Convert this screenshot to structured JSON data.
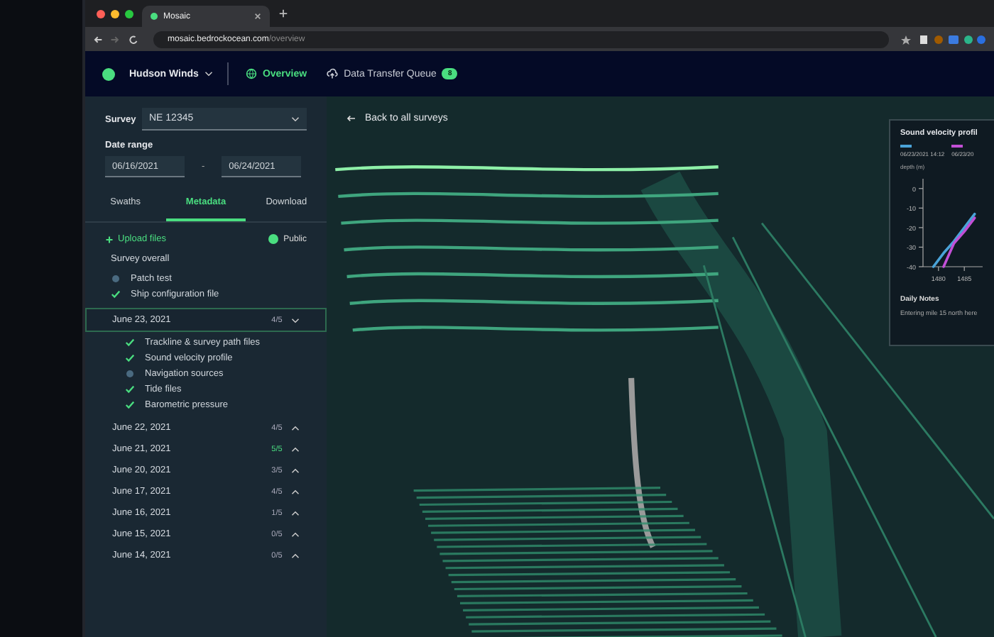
{
  "browser": {
    "tabs": [
      {
        "title": "Mosaic",
        "selected": true
      }
    ],
    "url_host": "mosaic.bedrockocean.com",
    "url_path": "/overview"
  },
  "header": {
    "workspace": "Hudson Winds",
    "nav": [
      {
        "label": "Overview",
        "selected": true
      },
      {
        "label": "Data Transfer Queue",
        "selected": false,
        "badge": "8"
      }
    ]
  },
  "sidebar": {
    "survey_label": "Survey",
    "survey_value": "NE 12345",
    "date_label": "Date range",
    "date_from": "06/16/2021",
    "date_separator": "-",
    "date_to": "06/24/2021",
    "tabs": [
      {
        "label": "Swaths",
        "selected": false
      },
      {
        "label": "Metadata",
        "selected": true
      },
      {
        "label": "Download",
        "selected": false
      }
    ],
    "upload": "Upload files",
    "public_label": "Public",
    "public_on": true,
    "overall_title": "Survey overall",
    "overall_items": [
      {
        "label": "Patch test",
        "done": false
      },
      {
        "label": "Ship configuration file",
        "done": true
      }
    ],
    "days": [
      {
        "date": "June 23, 2021",
        "count": "4/5",
        "complete": false,
        "expanded": true,
        "children": [
          {
            "label": "Trackline & survey path files",
            "done": true
          },
          {
            "label": "Sound velocity profile",
            "done": true
          },
          {
            "label": "Navigation sources",
            "done": false
          },
          {
            "label": "Tide files",
            "done": true
          },
          {
            "label": "Barometric pressure",
            "done": true
          }
        ]
      },
      {
        "date": "June 22, 2021",
        "count": "4/5",
        "complete": false,
        "expanded": false
      },
      {
        "date": "June 21, 2021",
        "count": "5/5",
        "complete": true,
        "expanded": false
      },
      {
        "date": "June 20, 2021",
        "count": "3/5",
        "complete": false,
        "expanded": false
      },
      {
        "date": "June 17, 2021",
        "count": "4/5",
        "complete": false,
        "expanded": false
      },
      {
        "date": "June 16, 2021",
        "count": "1/5",
        "complete": false,
        "expanded": false
      },
      {
        "date": "June 15, 2021",
        "count": "0/5",
        "complete": false,
        "expanded": false
      },
      {
        "date": "June 14, 2021",
        "count": "0/5",
        "complete": false,
        "expanded": false
      }
    ]
  },
  "map": {
    "back_link": "Back to all surveys",
    "panel": {
      "title": "Sound velocity profil",
      "chart_data": {
        "type": "line",
        "ylabel": "depth (m)",
        "x": [
          1479,
          1481,
          1483,
          1485,
          1487
        ],
        "xticks": [
          1480,
          1485
        ],
        "xlim": [
          1477,
          1488
        ],
        "yticks": [
          0,
          -10,
          -20,
          -30,
          -40
        ],
        "ylim": [
          -40,
          5
        ],
        "series": [
          {
            "name": "06/23/2021 14:12",
            "color": "#4aa3d8",
            "values": [
              -40,
              -33,
              -27,
              -20,
              -13
            ]
          },
          {
            "name": "06/23/20",
            "color": "#c24fd6",
            "values": [
              null,
              -40,
              -28,
              -22,
              -15
            ]
          }
        ]
      },
      "notes_title": "Daily Notes",
      "notes_text": "Entering mile 15 north here"
    }
  }
}
